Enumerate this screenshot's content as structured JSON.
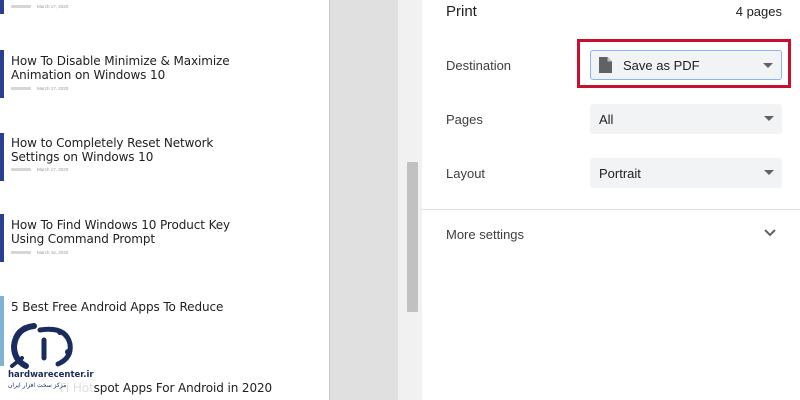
{
  "preview": {
    "first_date": "March 17, 2020",
    "articles": [
      {
        "title": "How To Disable Minimize & Maximize Animation on Windows 10",
        "date": "March 17, 2020"
      },
      {
        "title": "How to Completely Reset Network Settings on Windows 10",
        "date": "March 17, 2020"
      },
      {
        "title": "How To Find Windows 10 Product Key Using Command Prompt",
        "date": "March 16, 2020"
      },
      {
        "title": "5 Best Free Android Apps To Reduce",
        "date": ""
      },
      {
        "title": "Fi Hotspot Apps For Android in 2020",
        "date": ""
      }
    ]
  },
  "watermark": {
    "site": "hardwarecenter.ir",
    "subtitle": "مرکز سخت افزار ایران"
  },
  "print_panel": {
    "title": "Print",
    "page_count": "4 pages",
    "destination_label": "Destination",
    "destination_value": "Save as PDF",
    "destination_icon": "document-icon",
    "pages_label": "Pages",
    "pages_value": "All",
    "layout_label": "Layout",
    "layout_value": "Portrait",
    "more_settings_label": "More settings"
  },
  "colors": {
    "highlight": "#c8102e",
    "select_bg": "#f1f3f4",
    "focus_border": "#8ab4f8"
  }
}
